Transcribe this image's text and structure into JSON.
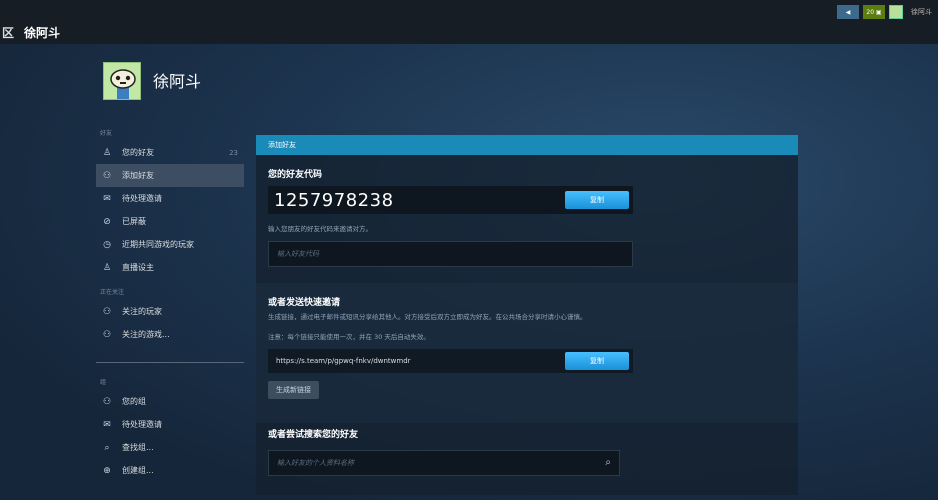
{
  "topbar": {
    "nav_prefix": "区",
    "username": "徐阿斗",
    "badge1": "◀",
    "badge2": "20 ▣",
    "user_short": "徐阿斗"
  },
  "profile": {
    "name": "徐阿斗"
  },
  "sidebar": {
    "section_friends": "好友",
    "items": [
      {
        "icon": "person-icon",
        "glyph": "♙",
        "label": "您的好友",
        "count": "23"
      },
      {
        "icon": "add-person-icon",
        "glyph": "⚇",
        "label": "添加好友"
      },
      {
        "icon": "mail-icon",
        "glyph": "✉",
        "label": "待处理邀请"
      },
      {
        "icon": "blocked-icon",
        "glyph": "⊘",
        "label": "已屏蔽"
      },
      {
        "icon": "clock-icon",
        "glyph": "◷",
        "label": "近期共同游戏的玩家"
      },
      {
        "icon": "person-icon",
        "glyph": "♙",
        "label": "直播设主"
      }
    ],
    "section_following": "正在关注",
    "following_items": [
      {
        "icon": "follow-person-icon",
        "glyph": "⚇",
        "label": "关注的玩家"
      },
      {
        "icon": "follow-game-icon",
        "glyph": "⚇",
        "label": "关注的游戏..."
      }
    ],
    "section_groups": "组",
    "group_items": [
      {
        "icon": "group-icon",
        "glyph": "⚇",
        "label": "您的组"
      },
      {
        "icon": "mail-icon",
        "glyph": "✉",
        "label": "待处理邀请"
      },
      {
        "icon": "search-icon",
        "glyph": "⌕",
        "label": "查找组..."
      },
      {
        "icon": "plus-circle-icon",
        "glyph": "⊕",
        "label": "创建组..."
      }
    ]
  },
  "panel": {
    "header": "添加好友",
    "code_title": "您的好友代码",
    "code_value": "1257978238",
    "copy_label": "复制",
    "code_hint": "输入您朋友的好友代码来邀请对方。",
    "code_input_placeholder": "输入好友代码",
    "invite_title": "或者发送快速邀请",
    "invite_desc": "生成链接，通过电子邮件或短讯分享给其他人。对方接受后双方立即成为好友。在公共场合分享时请小心谨慎。",
    "invite_note": "注意：每个链接只能使用一次，并在 30 天后自动失效。",
    "invite_link": "https://s.team/p/gpwq-fnkv/dwntwmdr",
    "copy_label2": "复制",
    "gen_label": "生成新链接",
    "search_title": "或者尝试搜索您的好友",
    "search_placeholder": "输入好友的个人资料名称"
  }
}
